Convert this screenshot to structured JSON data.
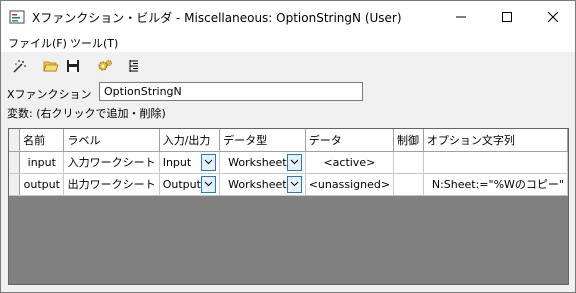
{
  "window": {
    "title": "Xファンクション・ビルダ - Miscellaneous: OptionStringN (User)"
  },
  "menu": [
    "ファイル(F)",
    "ツール(T)"
  ],
  "toolbar": {
    "icons": [
      "wand-icon",
      "folder-open-icon",
      "save-icon",
      "gear-icon",
      "tree-icon"
    ]
  },
  "form": {
    "xfunction_label": "Xファンクション",
    "xfunction_value": "OptionStringN",
    "variables_label": "変数: (右クリックで追加・削除)"
  },
  "table": {
    "headers": [
      "名前",
      "ラベル",
      "入力/出力",
      "データ型",
      "データ",
      "制御",
      "オプション文字列"
    ],
    "rows": [
      {
        "name": "input",
        "label": "入力ワークシート",
        "io": "Input",
        "type": "Worksheet",
        "data": "<active>",
        "control": "",
        "option": ""
      },
      {
        "name": "output",
        "label": "出力ワークシート",
        "io": "Output",
        "type": "Worksheet",
        "data": "<unassigned>",
        "control": "",
        "option": "N:Sheet:=\"%Wのコピー\""
      }
    ]
  },
  "colors": {
    "accent": "#2a74c7",
    "empty_area": "#808080"
  }
}
